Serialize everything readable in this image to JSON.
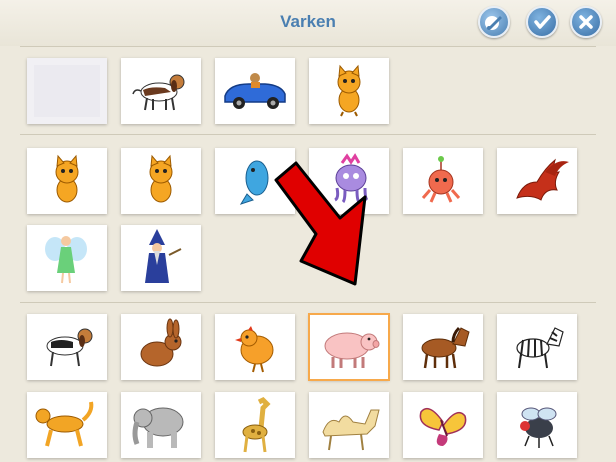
{
  "header": {
    "title": "Varken",
    "buttons": [
      {
        "name": "paint-button",
        "icon": "paint-brush-icon"
      },
      {
        "name": "ok-button",
        "icon": "check-icon"
      },
      {
        "name": "close-button",
        "icon": "close-icon"
      }
    ]
  },
  "sections": [
    {
      "name": "backgrounds-section",
      "items": [
        "blank",
        "dog",
        "car",
        "cat"
      ]
    },
    {
      "name": "characters-section",
      "items": [
        "cat",
        "cat",
        "fish",
        "octopus",
        "monster",
        "dragon",
        "fairy",
        "wizard"
      ]
    },
    {
      "name": "animals-section",
      "items": [
        "beagle",
        "rabbit",
        "chicken",
        "pig",
        "horse",
        "zebra",
        "monkey",
        "elephant",
        "giraffe",
        "camel",
        "butterfly",
        "fly"
      ]
    }
  ],
  "selected": "pig",
  "colors": {
    "accent": "#4a7fb1",
    "selection": "#f7a94b",
    "arrow": "#e00000"
  }
}
